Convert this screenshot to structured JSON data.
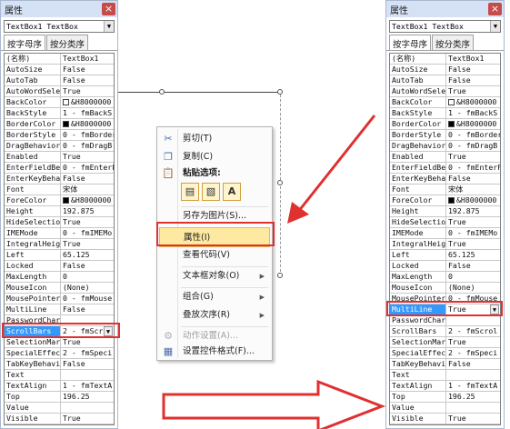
{
  "left_panel": {
    "title": "属性",
    "close_glyph": "×",
    "object_selector": "TextBox1 TextBox",
    "dropdown_glyph": "▼",
    "tabs": [
      {
        "label": "按字母序"
      },
      {
        "label": "按分类序"
      }
    ],
    "rows": [
      {
        "name": "(名称)",
        "value": "TextBox1"
      },
      {
        "name": "AutoSize",
        "value": "False"
      },
      {
        "name": "AutoTab",
        "value": "False"
      },
      {
        "name": "AutoWordSelect",
        "value": "True"
      },
      {
        "name": "BackColor",
        "value": "&H8000000",
        "swatch": "white"
      },
      {
        "name": "BackStyle",
        "value": "1 - fmBackS"
      },
      {
        "name": "BorderColor",
        "value": "&H8000000",
        "swatch": "black"
      },
      {
        "name": "BorderStyle",
        "value": "0 - fmBorder"
      },
      {
        "name": "DragBehavior",
        "value": "0 - fmDragB"
      },
      {
        "name": "Enabled",
        "value": "True"
      },
      {
        "name": "EnterFieldBehavior",
        "value": "0 - fmEnterF"
      },
      {
        "name": "EnterKeyBehavior",
        "value": "False"
      },
      {
        "name": "Font",
        "value": "宋体"
      },
      {
        "name": "ForeColor",
        "value": "&H8000000",
        "swatch": "black"
      },
      {
        "name": "Height",
        "value": "192.875"
      },
      {
        "name": "HideSelection",
        "value": "True"
      },
      {
        "name": "IMEMode",
        "value": "0 - fmIMEMo"
      },
      {
        "name": "IntegralHeight",
        "value": "True"
      },
      {
        "name": "Left",
        "value": "65.125"
      },
      {
        "name": "Locked",
        "value": "False"
      },
      {
        "name": "MaxLength",
        "value": "0"
      },
      {
        "name": "MouseIcon",
        "value": "(None)"
      },
      {
        "name": "MousePointer",
        "value": "0 - fmMouse"
      },
      {
        "name": "MultiLine",
        "value": "False"
      },
      {
        "name": "PasswordChar",
        "value": ""
      },
      {
        "name": "ScrollBars",
        "value": "2 - fmScr",
        "selected": true
      },
      {
        "name": "SelectionMargin",
        "value": "True"
      },
      {
        "name": "SpecialEffect",
        "value": "2 - fmSpeci"
      },
      {
        "name": "TabKeyBehavior",
        "value": "False"
      },
      {
        "name": "Text",
        "value": ""
      },
      {
        "name": "TextAlign",
        "value": "1 - fmTextA"
      },
      {
        "name": "Top",
        "value": "196.25"
      },
      {
        "name": "Value",
        "value": ""
      },
      {
        "name": "Visible",
        "value": "True"
      }
    ]
  },
  "right_panel": {
    "title": "属性",
    "close_glyph": "×",
    "object_selector": "TextBox1 TextBox",
    "dropdown_glyph": "▼",
    "tabs": [
      {
        "label": "按字母序"
      },
      {
        "label": "按分类序"
      }
    ],
    "rows": [
      {
        "name": "(名称)",
        "value": "TextBox1"
      },
      {
        "name": "AutoSize",
        "value": "False"
      },
      {
        "name": "AutoTab",
        "value": "False"
      },
      {
        "name": "AutoWordSelect",
        "value": "True"
      },
      {
        "name": "BackColor",
        "value": "&H8000000",
        "swatch": "white"
      },
      {
        "name": "BackStyle",
        "value": "1 - fmBackS"
      },
      {
        "name": "BorderColor",
        "value": "&H8000000",
        "swatch": "black"
      },
      {
        "name": "BorderStyle",
        "value": "0 - fmBorder"
      },
      {
        "name": "DragBehavior",
        "value": "0 - fmDragB"
      },
      {
        "name": "Enabled",
        "value": "True"
      },
      {
        "name": "EnterFieldBehavior",
        "value": "0 - fmEnterF"
      },
      {
        "name": "EnterKeyBehavior",
        "value": "False"
      },
      {
        "name": "Font",
        "value": "宋体"
      },
      {
        "name": "ForeColor",
        "value": "&H8000000",
        "swatch": "black"
      },
      {
        "name": "Height",
        "value": "192.875"
      },
      {
        "name": "HideSelection",
        "value": "True"
      },
      {
        "name": "IMEMode",
        "value": "0 - fmIMEMo"
      },
      {
        "name": "IntegralHeight",
        "value": "True"
      },
      {
        "name": "Left",
        "value": "65.125"
      },
      {
        "name": "Locked",
        "value": "False"
      },
      {
        "name": "MaxLength",
        "value": "0"
      },
      {
        "name": "MouseIcon",
        "value": "(None)"
      },
      {
        "name": "MousePointer",
        "value": "0 - fmMouse"
      },
      {
        "name": "MultiLine",
        "value": "True",
        "selected": true
      },
      {
        "name": "PasswordChar",
        "value": ""
      },
      {
        "name": "ScrollBars",
        "value": "2 - fmScrol"
      },
      {
        "name": "SelectionMargin",
        "value": "True"
      },
      {
        "name": "SpecialEffect",
        "value": "2 - fmSpeci"
      },
      {
        "name": "TabKeyBehavior",
        "value": "False"
      },
      {
        "name": "Text",
        "value": ""
      },
      {
        "name": "TextAlign",
        "value": "1 - fmTextA"
      },
      {
        "name": "Top",
        "value": "196.25"
      },
      {
        "name": "Value",
        "value": ""
      },
      {
        "name": "Visible",
        "value": "True"
      }
    ]
  },
  "context_menu": {
    "cut": "剪切(T)",
    "copy": "复制(C)",
    "paste_options": "粘贴选项:",
    "save_as_image": "另存为图片(S)...",
    "properties": "属性(I)",
    "view_code": "查看代码(V)",
    "textbox_object": "文本框对象(O)",
    "group": "组合(G)",
    "order": "叠放次序(R)",
    "action_settings": "动作设置(A)...",
    "format_control": "设置控件格式(F)...",
    "paste_letter": "A",
    "submenu_glyph": "▶"
  },
  "colors": {
    "selection": "#3399ff",
    "highlight_box": "#e03030",
    "menu_hover": "#fde9a0",
    "title_bar": "#d5e2f5"
  },
  "icons": [
    "scissors-icon",
    "copy-icon",
    "paste-icon",
    "close-icon",
    "dropdown-arrow-icon",
    "submenu-arrow-icon",
    "red-arrow-icon",
    "outline-arrow-icon"
  ]
}
